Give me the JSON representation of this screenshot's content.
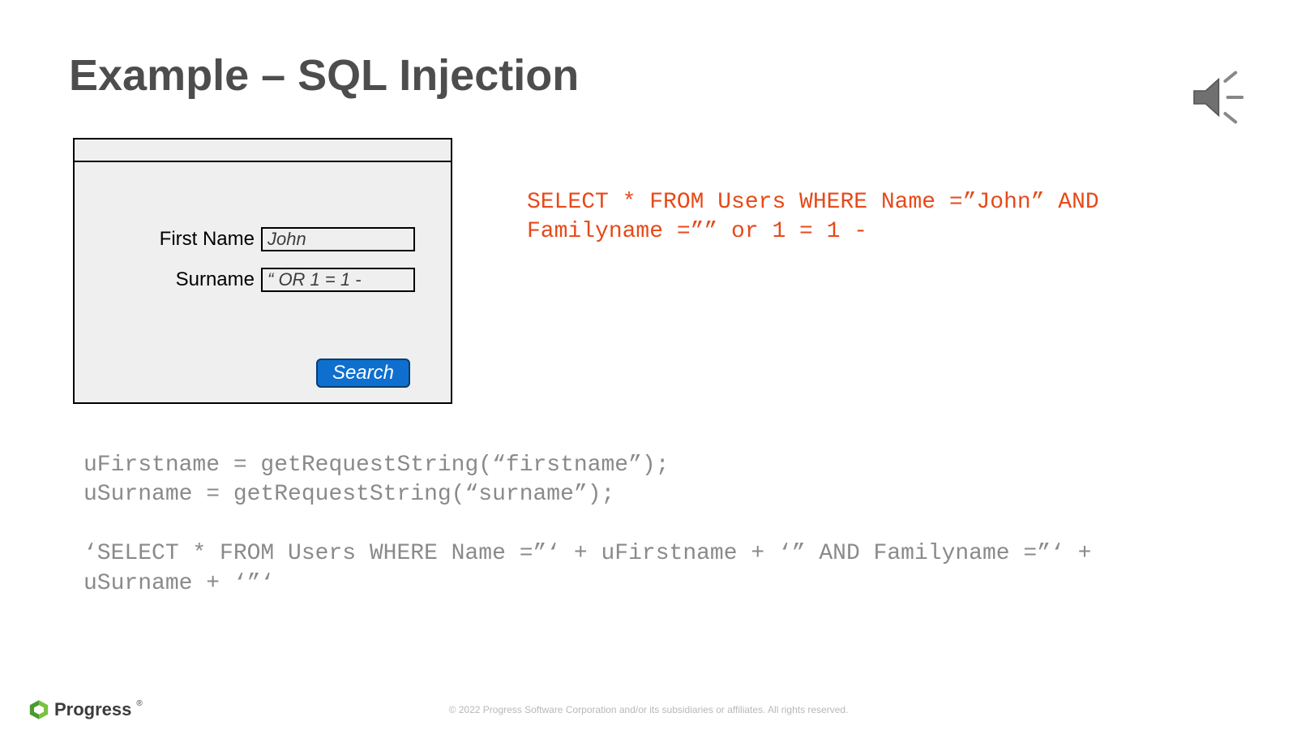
{
  "title": "Example – SQL Injection",
  "form": {
    "first_name_label": "First Name",
    "first_name_value": "John",
    "surname_label": "Surname",
    "surname_value": "“ OR 1 = 1 -",
    "search_label": "Search"
  },
  "result_sql": "SELECT * FROM Users WHERE Name =”John” AND Familyname =”” or 1 = 1 -",
  "code_block": "uFirstname = getRequestString(“firstname”);\nuSurname = getRequestString(“surname”);\n\n‘SELECT * FROM Users WHERE Name =”‘ + uFirstname + ‘” AND Familyname =”‘ + uSurname + ‘”‘",
  "footer": {
    "brand": "Progress",
    "copyright": "© 2022 Progress Software Corporation and/or its subsidiaries or affiliates. All rights reserved."
  }
}
